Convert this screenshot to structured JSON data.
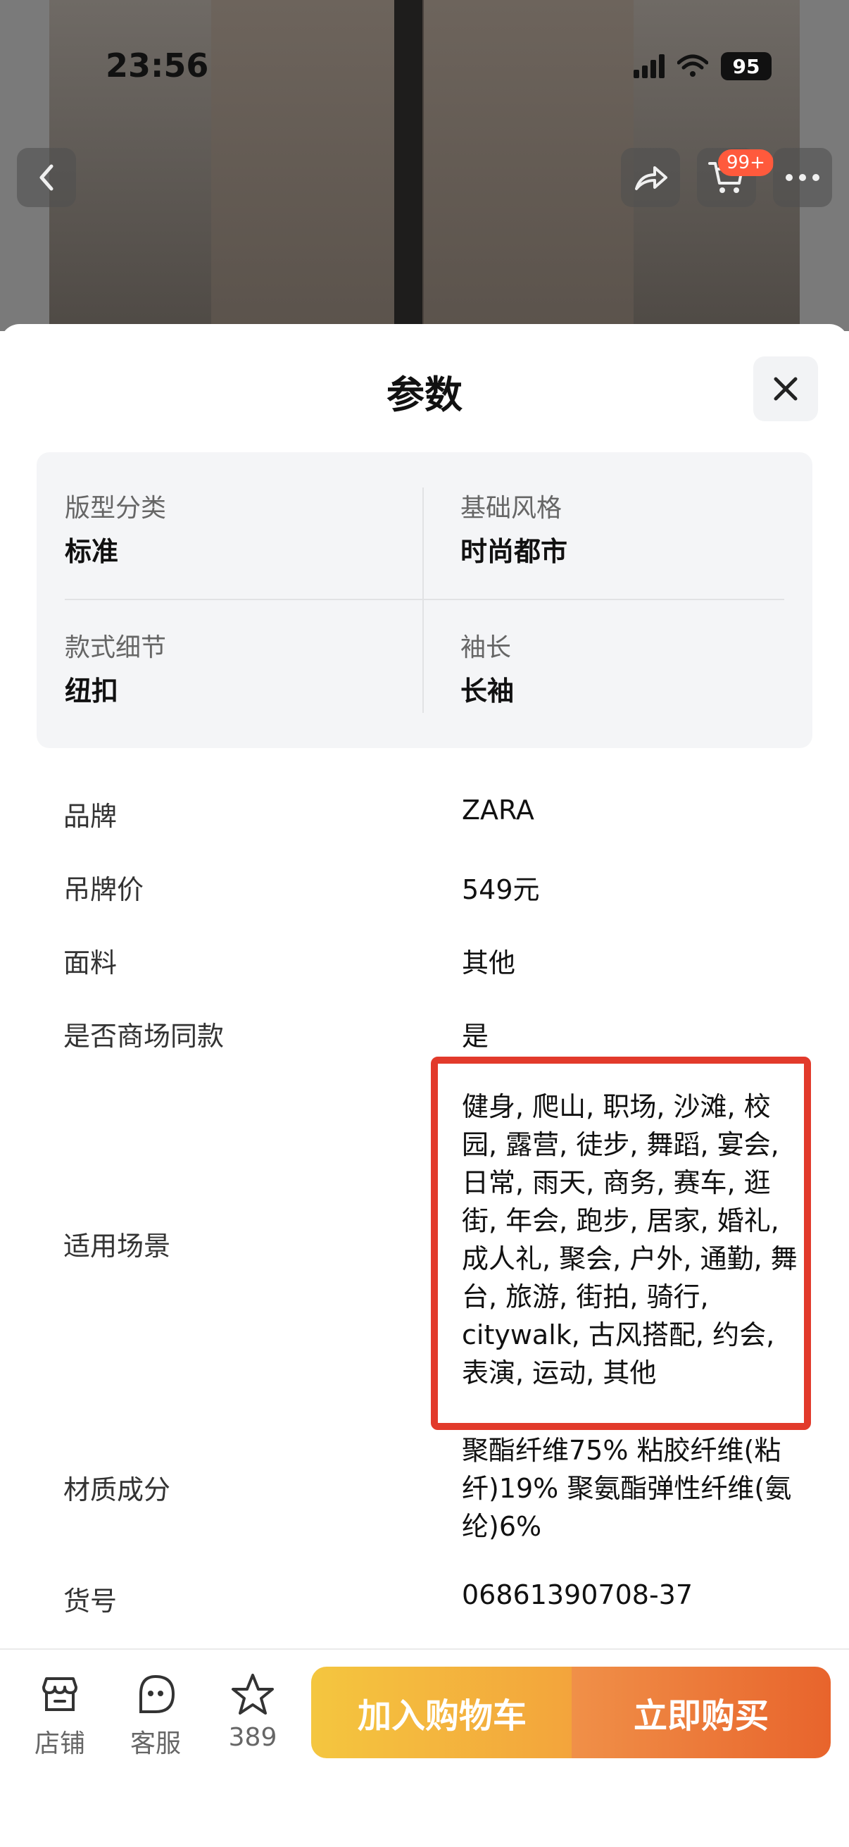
{
  "status": {
    "time": "23:56",
    "battery": "95"
  },
  "header": {
    "cart_badge": "99+"
  },
  "sheet": {
    "title": "参数"
  },
  "summary_card": [
    {
      "label": "版型分类",
      "value": "标准"
    },
    {
      "label": "基础风格",
      "value": "时尚都市"
    },
    {
      "label": "款式细节",
      "value": "纽扣"
    },
    {
      "label": "袖长",
      "value": "长袖"
    }
  ],
  "specs": [
    {
      "label": "品牌",
      "value": "ZARA"
    },
    {
      "label": "吊牌价",
      "value": "549元"
    },
    {
      "label": "面料",
      "value": "其他"
    },
    {
      "label": "是否商场同款",
      "value": "是"
    },
    {
      "label": "适用场景",
      "value": "健身, 爬山, 职场, 沙滩, 校园, 露营, 徒步, 舞蹈, 宴会, 日常, 雨天, 商务, 赛车, 逛街, 年会, 跑步, 居家, 婚礼, 成人礼, 聚会, 户外, 通勤, 舞台, 旅游, 街拍, 骑行, citywalk, 古风搭配, 约会, 表演, 运动, 其他"
    },
    {
      "label": "材质成分",
      "value": "聚酯纤维75% 粘胶纤维(粘纤)19% 聚氨酯弹性纤维(氨纶)6%"
    },
    {
      "label": "货号",
      "value": "06861390708-37"
    }
  ],
  "bottom_bar": {
    "shop": "店铺",
    "service": "客服",
    "favorites_count": "389",
    "add_to_cart": "加入购物车",
    "buy_now": "立即购买"
  },
  "colors": {
    "accent_red": "#e23a2b",
    "cta_yellow": "#f4c63f",
    "cta_orange": "#e8642c"
  }
}
